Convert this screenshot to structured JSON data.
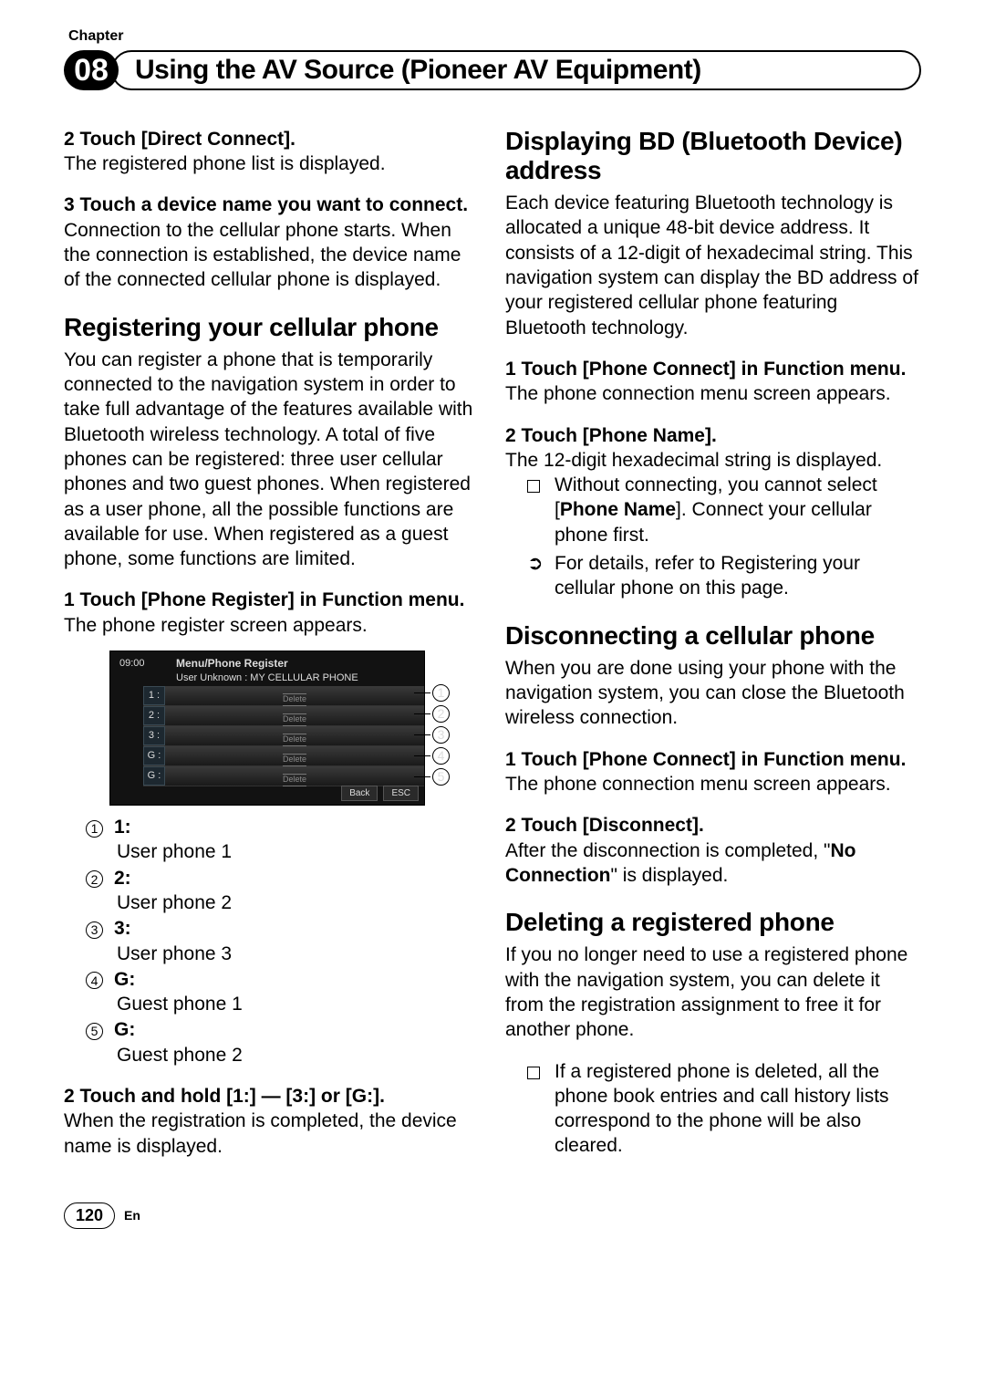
{
  "chapter_label": "Chapter",
  "chapter_num": "08",
  "chapter_title": "Using the AV Source (Pioneer AV Equipment)",
  "left": {
    "step2_head": "2   Touch [Direct Connect].",
    "step2_body": "The registered phone list is displayed.",
    "step3_head": "3   Touch a device name you want to connect.",
    "step3_body": "Connection to the cellular phone starts. When the connection is established, the device name of the connected cellular phone is displayed.",
    "sec_reg_title": "Registering your cellular phone",
    "sec_reg_body": "You can register a phone that is temporarily connected to the navigation system in order to take full advantage of the features available with Bluetooth wireless technology. A total of five phones can be registered: three user cellular phones and two guest phones. When registered as a user phone, all the possible functions are available for use. When registered as a guest phone, some functions are limited.",
    "reg1_head": "1   Touch [Phone Register] in Function menu.",
    "reg1_body": "The phone register screen appears.",
    "screenshot": {
      "time": "09:00",
      "title": "Menu/Phone Register",
      "sub": "User Unknown : MY CELLULAR PHONE",
      "rows": [
        "1 :",
        "2 :",
        "3 :",
        "G :",
        "G :"
      ],
      "delete": "Delete",
      "back": "Back",
      "esc": "ESC"
    },
    "callouts": [
      {
        "num": "1",
        "lbl": "1:",
        "desc": "User phone 1"
      },
      {
        "num": "2",
        "lbl": "2:",
        "desc": "User phone 2"
      },
      {
        "num": "3",
        "lbl": "3:",
        "desc": "User phone 3"
      },
      {
        "num": "4",
        "lbl": "G:",
        "desc": "Guest phone 1"
      },
      {
        "num": "5",
        "lbl": "G:",
        "desc": "Guest phone 2"
      }
    ],
    "reg2_head": "2   Touch and hold [1:] — [3:] or [G:].",
    "reg2_body": "When the registration is completed, the device name is displayed."
  },
  "right": {
    "sec_bd_title": "Displaying BD (Bluetooth Device) address",
    "sec_bd_body": "Each device featuring Bluetooth technology is allocated a unique 48-bit device address. It consists of a 12-digit of hexadecimal string. This navigation system can display the BD address of your registered cellular phone featuring Bluetooth technology.",
    "bd1_head": "1   Touch [Phone Connect] in Function menu.",
    "bd1_body": "The phone connection menu screen appears.",
    "bd2_head": "2   Touch [Phone Name].",
    "bd2_body": "The 12-digit hexadecimal string is displayed.",
    "bd_note1_pre": "Without connecting, you cannot select [",
    "bd_note1_bold": "Phone Name",
    "bd_note1_post": "]. Connect your cellular phone first.",
    "bd_note2_pre": "For details, refer to ",
    "bd_note2_link": "Registering your cellular phone",
    "bd_note2_post": " on this page.",
    "sec_disc_title": "Disconnecting a cellular phone",
    "sec_disc_body": "When you are done using your phone with the navigation system, you can close the Bluetooth wireless connection.",
    "disc1_head": "1   Touch [Phone Connect] in Function menu.",
    "disc1_body": "The phone connection menu screen appears.",
    "disc2_head": "2   Touch [Disconnect].",
    "disc2_body_pre": "After the disconnection is completed, \"",
    "disc2_body_bold": "No Connection",
    "disc2_body_post": "\" is displayed.",
    "sec_del_title": "Deleting a registered phone",
    "sec_del_body": "If you no longer need to use a registered phone with the navigation system, you can delete it from the registration assignment to free it for another phone.",
    "del_note": "If a registered phone is deleted, all the phone book entries and call history lists correspond to the phone will be also cleared."
  },
  "page_num": "120",
  "lang": "En"
}
